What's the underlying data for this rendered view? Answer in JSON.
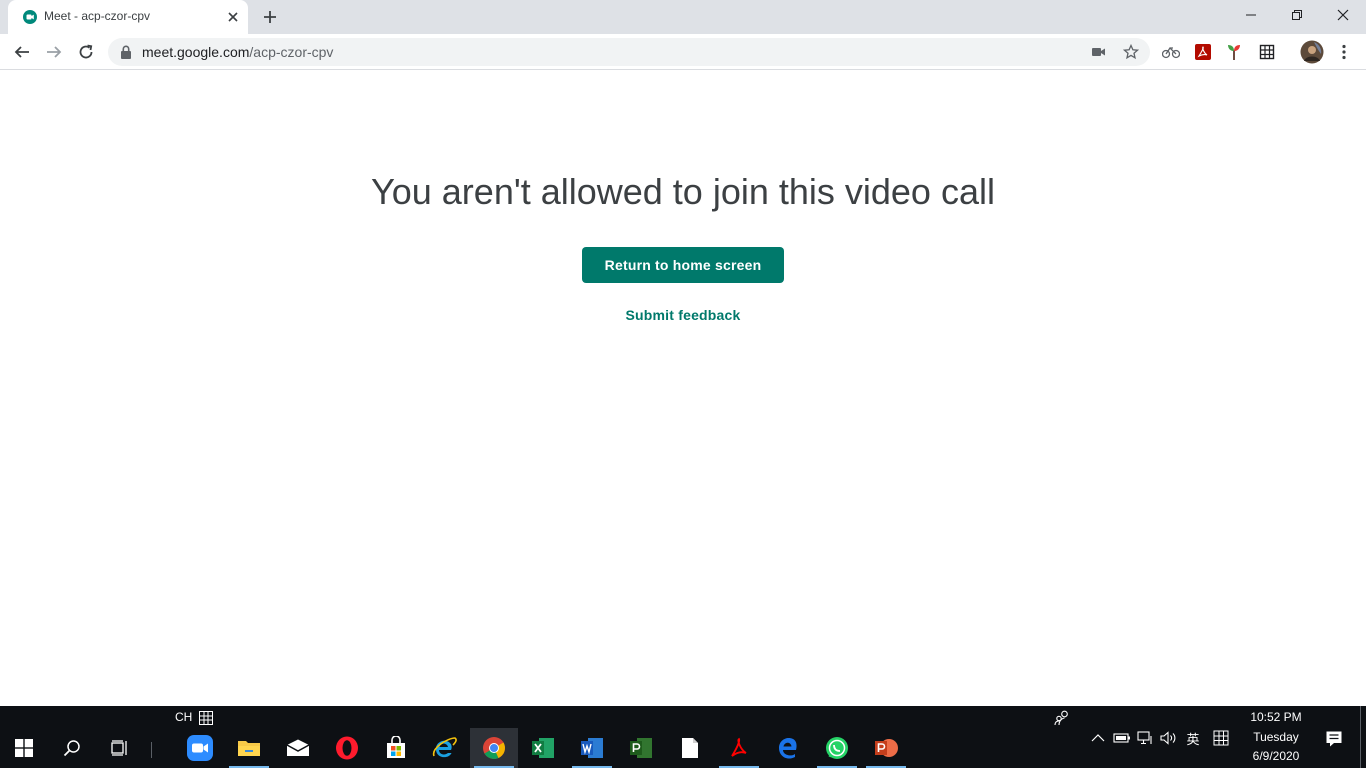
{
  "browser": {
    "tab": {
      "title": "Meet - acp-czor-cpv",
      "favicon": "google-meet-icon"
    },
    "url": {
      "domain": "meet.google.com",
      "path": "/acp-czor-cpv"
    }
  },
  "page": {
    "heading": "You aren't allowed to join this video call",
    "return_button": "Return to home screen",
    "feedback_link": "Submit feedback"
  },
  "colors": {
    "accent": "#00796b",
    "heading": "#3c4043",
    "taskbar": "#0d1014"
  },
  "taskbar": {
    "ime_label": "CH",
    "language_indicator": "英",
    "clock": {
      "time": "10:52 PM",
      "day": "Tuesday",
      "date": "6/9/2020"
    },
    "pinned_apps": [
      "zoom",
      "file-explorer",
      "mail",
      "opera",
      "microsoft-store",
      "internet-explorer",
      "chrome",
      "excel",
      "word",
      "project",
      "notepad",
      "acrobat",
      "edge",
      "whatsapp",
      "powerpoint"
    ],
    "active_app": "chrome"
  }
}
